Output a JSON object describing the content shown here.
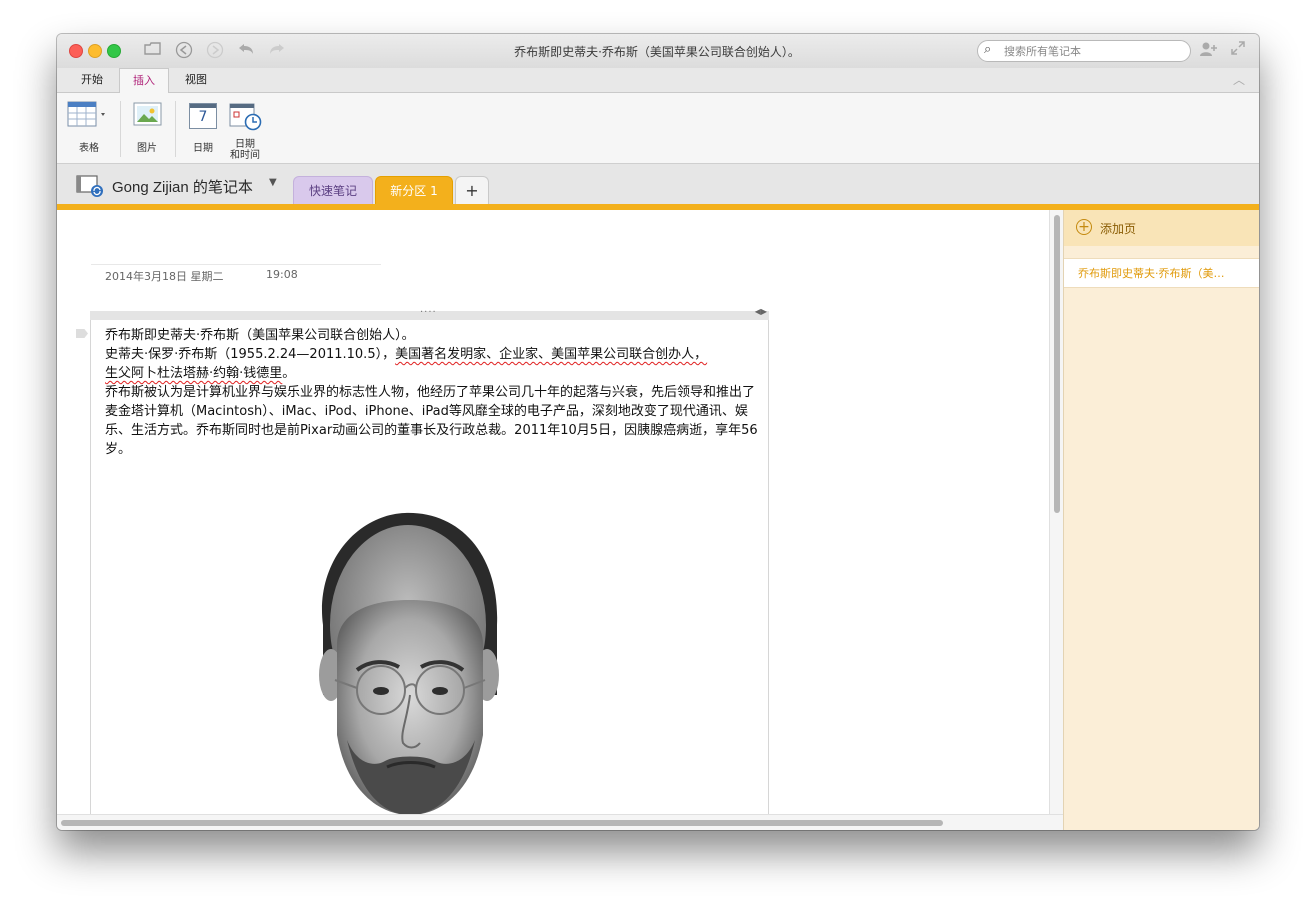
{
  "window": {
    "title": "乔布斯即史蒂夫·乔布斯（美国苹果公司联合创始人）。"
  },
  "toolbar": {
    "search_placeholder": "搜索所有笔记本"
  },
  "ribbon_tabs": [
    {
      "label": "开始",
      "active": false
    },
    {
      "label": "插入",
      "active": true
    },
    {
      "label": "视图",
      "active": false
    }
  ],
  "ribbon": {
    "table_label": "表格",
    "picture_label": "图片",
    "date_label": "日期",
    "date_icon_number": "7",
    "datetime_label_1": "日期",
    "datetime_label_2": "和时间"
  },
  "notebook": {
    "name": "Gong Zijian 的笔记本",
    "sections": [
      {
        "label": "快速笔记",
        "color": "#d9c9ec"
      },
      {
        "label": "新分区 1",
        "color": "#f3b01c",
        "active": true
      }
    ],
    "add_section_label": "+"
  },
  "page": {
    "date": "2014年3月18日 星期二",
    "time": "19:08",
    "paragraphs": {
      "p1": "乔布斯即史蒂夫·乔布斯（美国苹果公司联合创始人）。",
      "p2a": "史蒂夫·保罗·乔布斯（1955.2.24—2011.10.5），",
      "p2b": "美国著名发明家、企业家、美国苹果公司联合创办人，",
      "p2c": "生父阿卜杜法塔赫·约翰·钱德里",
      "p2d": "。",
      "p3": "乔布斯被认为是计算机业界与娱乐业界的标志性人物，他经历了苹果公司几十年的起落与兴衰，先后领导和推出了麦金塔计算机（Macintosh）、iMac、iPod、iPhone、iPad等风靡全球的电子产品，深刻地改变了现代通讯、娱乐、生活方式。乔布斯同时也是前Pixar动画公司的董事长及行政总裁。2011年10月5日，因胰腺癌病逝，享年56岁。"
    }
  },
  "sidebar": {
    "add_page_label": "添加页",
    "pages": [
      "乔布斯即史蒂夫·乔布斯（美…"
    ]
  },
  "colors": {
    "accent": "#f3b01c",
    "active_tab_text": "#b0247a",
    "sidebar_bg": "#fbeed7"
  }
}
